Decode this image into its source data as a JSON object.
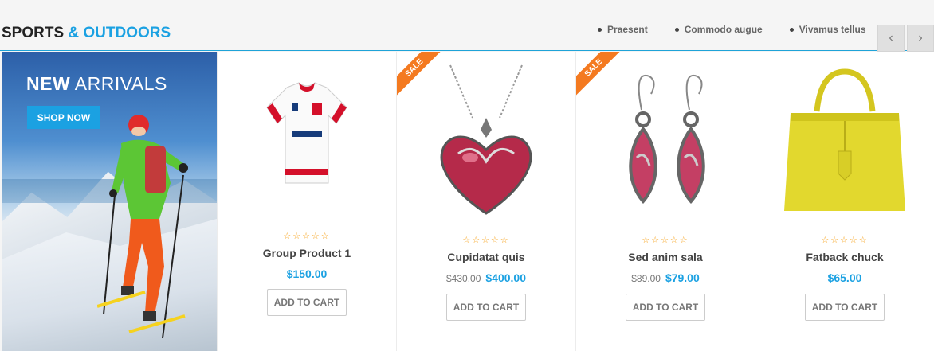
{
  "section": {
    "title_main": "SPORTS",
    "title_accent": "& OUTDOORS",
    "tabs": [
      "Praesent",
      "Commodo augue",
      "Vivamus tellus"
    ],
    "prev_icon": "‹",
    "next_icon": "›"
  },
  "banner": {
    "heading_bold": "NEW",
    "heading_rest": " ARRIVALS",
    "button": "SHOP NOW"
  },
  "products": [
    {
      "name": "Group Product 1",
      "price": "$150.00",
      "old_price": "",
      "sale": false,
      "stars": "☆☆☆☆☆",
      "cart": "ADD TO CART"
    },
    {
      "name": "Cupidatat quis",
      "price": "$400.00",
      "old_price": "$430.00",
      "sale": true,
      "sale_label": "SALE",
      "stars": "☆☆☆☆☆",
      "cart": "ADD TO CART"
    },
    {
      "name": "Sed anim sala",
      "price": "$79.00",
      "old_price": "$89.00",
      "sale": true,
      "sale_label": "SALE",
      "stars": "☆☆☆☆☆",
      "cart": "ADD TO CART"
    },
    {
      "name": "Fatback chuck",
      "price": "$65.00",
      "old_price": "",
      "sale": false,
      "stars": "☆☆☆☆☆",
      "cart": "ADD TO CART"
    }
  ],
  "colors": {
    "accent": "#1ba1e2",
    "sale": "#f47a20",
    "stars": "#f7a21b"
  }
}
